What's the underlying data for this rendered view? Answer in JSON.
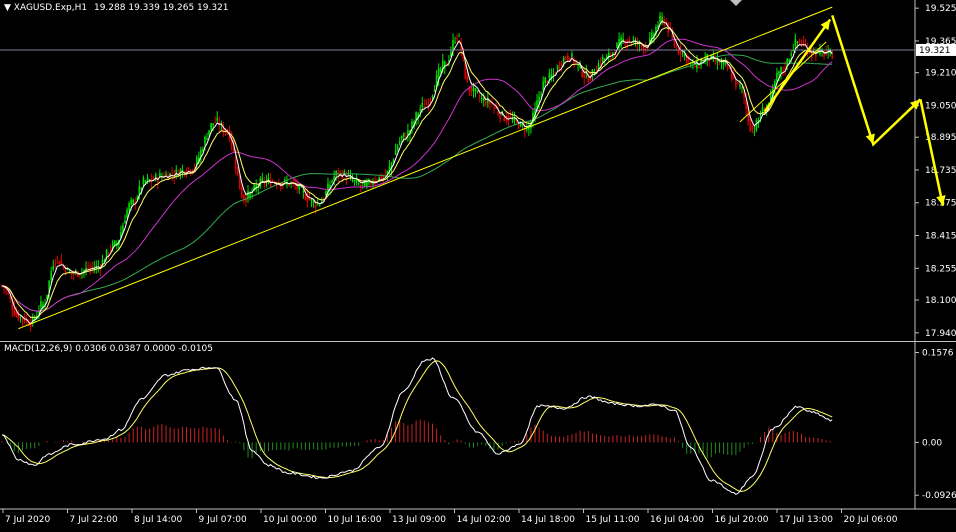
{
  "chart_data": [
    {
      "type": "candlestick",
      "title": "XAGUSD.Exp,H1",
      "ohlc_readout": "19.288 19.339 19.265 19.321",
      "current_price": 19.321,
      "current_price_label": "19.321",
      "ylim": [
        17.9,
        19.56
      ],
      "yticks": [
        "17.940",
        "18.100",
        "18.255",
        "18.415",
        "18.575",
        "18.735",
        "18.895",
        "19.050",
        "19.210",
        "19.365",
        "19.525"
      ],
      "x_labels": [
        "7 Jul 2020",
        "7 Jul 22:00",
        "8 Jul 14:00",
        "9 Jul 07:00",
        "10 Jul 00:00",
        "10 Jul 16:00",
        "13 Jul 09:00",
        "14 Jul 02:00",
        "14 Jul 18:00",
        "15 Jul 11:00",
        "16 Jul 04:00",
        "16 Jul 20:00",
        "17 Jul 13:00",
        "20 Jul 06:00"
      ],
      "anchors": [
        [
          0,
          18.17
        ],
        [
          8,
          18.02
        ],
        [
          14,
          17.99
        ],
        [
          20,
          18.08
        ],
        [
          26,
          18.3
        ],
        [
          34,
          18.23
        ],
        [
          46,
          18.26
        ],
        [
          55,
          18.37
        ],
        [
          63,
          18.57
        ],
        [
          70,
          18.68
        ],
        [
          80,
          18.71
        ],
        [
          92,
          18.74
        ],
        [
          104,
          18.97
        ],
        [
          110,
          18.92
        ],
        [
          118,
          18.6
        ],
        [
          128,
          18.68
        ],
        [
          140,
          18.67
        ],
        [
          154,
          18.57
        ],
        [
          164,
          18.72
        ],
        [
          176,
          18.66
        ],
        [
          186,
          18.7
        ],
        [
          196,
          18.9
        ],
        [
          206,
          19.05
        ],
        [
          216,
          19.25
        ],
        [
          222,
          19.39
        ],
        [
          228,
          19.13
        ],
        [
          236,
          19.07
        ],
        [
          246,
          18.99
        ],
        [
          256,
          18.94
        ],
        [
          266,
          19.18
        ],
        [
          276,
          19.29
        ],
        [
          286,
          19.19
        ],
        [
          294,
          19.28
        ],
        [
          304,
          19.37
        ],
        [
          314,
          19.34
        ],
        [
          322,
          19.47
        ],
        [
          330,
          19.32
        ],
        [
          338,
          19.24
        ],
        [
          344,
          19.28
        ],
        [
          352,
          19.25
        ],
        [
          360,
          19.14
        ],
        [
          366,
          18.93
        ],
        [
          372,
          19.03
        ],
        [
          380,
          19.22
        ],
        [
          388,
          19.36
        ],
        [
          396,
          19.31
        ],
        [
          405,
          19.3
        ]
      ],
      "indicators": {
        "ma_fast": {
          "color": "#ffffff"
        },
        "ma_mid": {
          "color": "#ffff66"
        },
        "ma_slow": {
          "color": "#cc33cc"
        },
        "ma_long": {
          "color": "#33aa55"
        }
      },
      "trendlines": [
        {
          "from": [
            8,
            17.96
          ],
          "to": [
            405,
            19.53
          ],
          "color": "#ffff00"
        },
        {
          "from": [
            360,
            18.97
          ],
          "to": [
            402,
            19.36
          ],
          "color": "#ffff00"
        }
      ],
      "forecast_arrows": [
        {
          "points": [
            [
              405,
              19.49
            ],
            [
              425,
              18.86
            ],
            [
              448,
              19.08
            ]
          ],
          "color": "#ffff00"
        },
        {
          "points": [
            [
              448,
              19.08
            ],
            [
              459,
              18.56
            ]
          ],
          "color": "#ffff00"
        }
      ],
      "colors": {
        "bull": "#00e000",
        "bear": "#e00000",
        "grid": "#5a5a5a",
        "price_line": "#8080a0"
      }
    },
    {
      "type": "histogram",
      "title": "MACD(12,26,9) 0.0306 0.0387 0.0000 -0.0105",
      "ylim": [
        -0.115,
        0.176
      ],
      "yticks": [
        "0.1576",
        "0.00",
        "-0.0926"
      ],
      "macd_anchors": [
        [
          0,
          0.014
        ],
        [
          8,
          -0.03
        ],
        [
          16,
          -0.04
        ],
        [
          22,
          -0.022
        ],
        [
          34,
          -0.004
        ],
        [
          50,
          0.006
        ],
        [
          58,
          0.022
        ],
        [
          68,
          0.076
        ],
        [
          80,
          0.118
        ],
        [
          92,
          0.128
        ],
        [
          104,
          0.132
        ],
        [
          114,
          0.075
        ],
        [
          122,
          -0.014
        ],
        [
          130,
          -0.04
        ],
        [
          140,
          -0.054
        ],
        [
          156,
          -0.062
        ],
        [
          170,
          -0.05
        ],
        [
          184,
          -0.01
        ],
        [
          196,
          0.09
        ],
        [
          206,
          0.143
        ],
        [
          210,
          0.146
        ],
        [
          220,
          0.078
        ],
        [
          232,
          0.018
        ],
        [
          242,
          -0.02
        ],
        [
          252,
          -0.004
        ],
        [
          262,
          0.064
        ],
        [
          274,
          0.06
        ],
        [
          286,
          0.08
        ],
        [
          298,
          0.068
        ],
        [
          310,
          0.064
        ],
        [
          320,
          0.066
        ],
        [
          328,
          0.056
        ],
        [
          336,
          -0.01
        ],
        [
          346,
          -0.066
        ],
        [
          358,
          -0.09
        ],
        [
          366,
          -0.06
        ],
        [
          376,
          0.024
        ],
        [
          388,
          0.062
        ],
        [
          396,
          0.052
        ],
        [
          405,
          0.038
        ]
      ],
      "colors": {
        "macd_line": "#ffffff",
        "signal_line": "#ffff66",
        "hist_pos": "#cc2222",
        "hist_neg": "#228822"
      }
    }
  ]
}
